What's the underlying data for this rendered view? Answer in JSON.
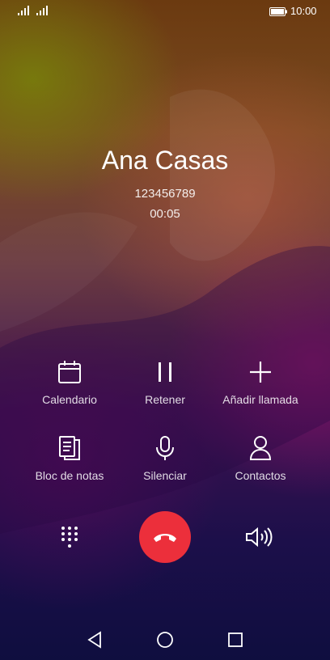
{
  "status_bar": {
    "time": "10:00",
    "icons": [
      "signal-1-icon",
      "signal-2-icon",
      "battery-icon"
    ]
  },
  "call": {
    "caller_name": "Ana Casas",
    "number": "123456789",
    "duration": "00:05"
  },
  "actions": [
    {
      "label": "Calendario",
      "icon": "calendar-icon"
    },
    {
      "label": "Retener",
      "icon": "pause-icon"
    },
    {
      "label": "Añadir llamada",
      "icon": "plus-icon"
    },
    {
      "label": "Bloc de notas",
      "icon": "notes-icon"
    },
    {
      "label": "Silenciar",
      "icon": "microphone-icon"
    },
    {
      "label": "Contactos",
      "icon": "contact-icon"
    }
  ],
  "bottom_controls": {
    "dialpad_icon": "dialpad-icon",
    "end_call_icon": "end-call-icon",
    "end_call_color": "#ec2f3b",
    "speaker_icon": "speaker-icon"
  },
  "nav_bar": {
    "icons": [
      "back-icon",
      "home-icon",
      "recents-icon"
    ]
  }
}
